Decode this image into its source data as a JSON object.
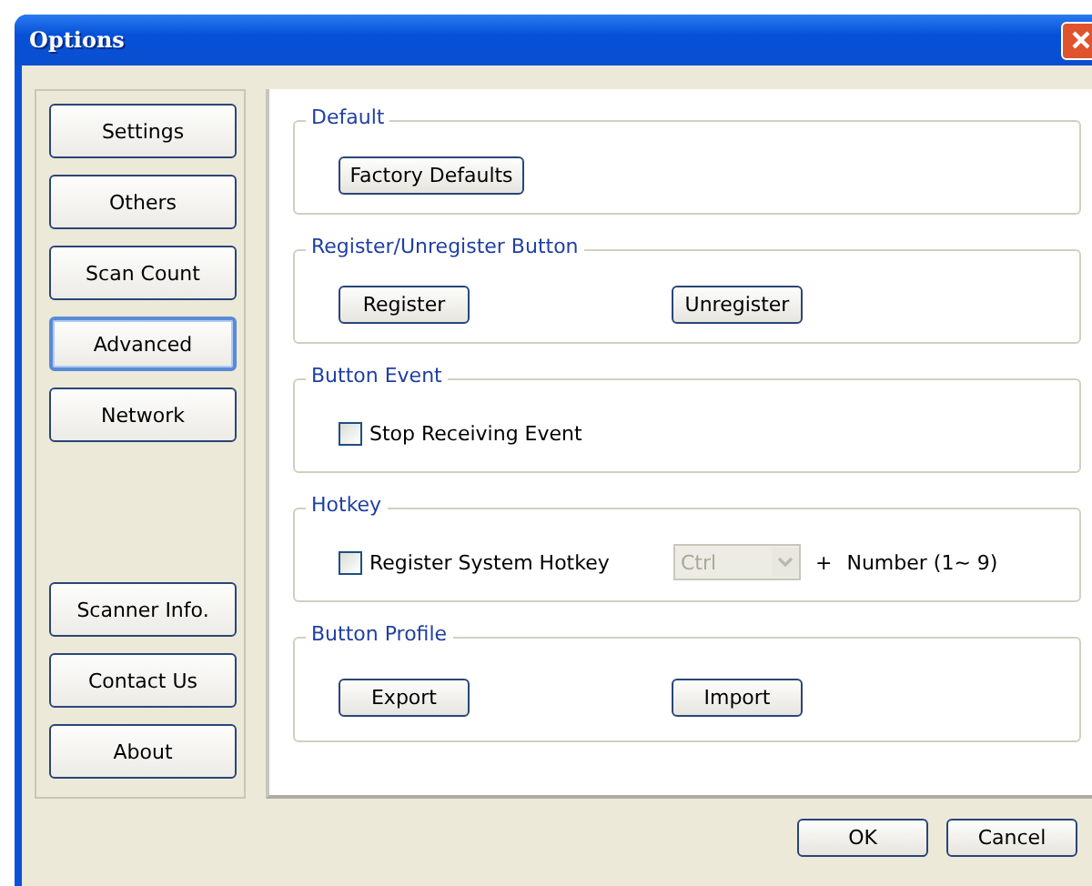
{
  "window": {
    "title": "Options"
  },
  "sidebar": {
    "items": [
      {
        "label": "Settings",
        "selected": false
      },
      {
        "label": "Others",
        "selected": false
      },
      {
        "label": "Scan Count",
        "selected": false
      },
      {
        "label": "Advanced",
        "selected": true
      },
      {
        "label": "Network",
        "selected": false
      }
    ],
    "bottom_items": [
      {
        "label": "Scanner Info.",
        "selected": false
      },
      {
        "label": "Contact Us",
        "selected": false
      },
      {
        "label": "About",
        "selected": false
      }
    ]
  },
  "groups": [
    {
      "title": "Default",
      "kind": "buttons",
      "buttons": [
        "Factory Defaults"
      ]
    },
    {
      "title": "Register/Unregister Button",
      "kind": "buttons",
      "buttons": [
        "Register",
        "Unregister"
      ]
    },
    {
      "title": "Button Event",
      "kind": "checkbox",
      "checkbox": {
        "label": "Stop Receiving Event",
        "checked": false
      }
    },
    {
      "title": "Hotkey",
      "kind": "hotkey",
      "checkbox": {
        "label": "Register System Hotkey",
        "checked": false
      },
      "combo": {
        "value": "Ctrl",
        "disabled": true
      },
      "plus": "+",
      "suffix": "Number (1~ 9)"
    },
    {
      "title": "Button Profile",
      "kind": "buttons",
      "buttons": [
        "Export",
        "Import"
      ]
    }
  ],
  "buttons": [
    "OK",
    "Cancel"
  ]
}
